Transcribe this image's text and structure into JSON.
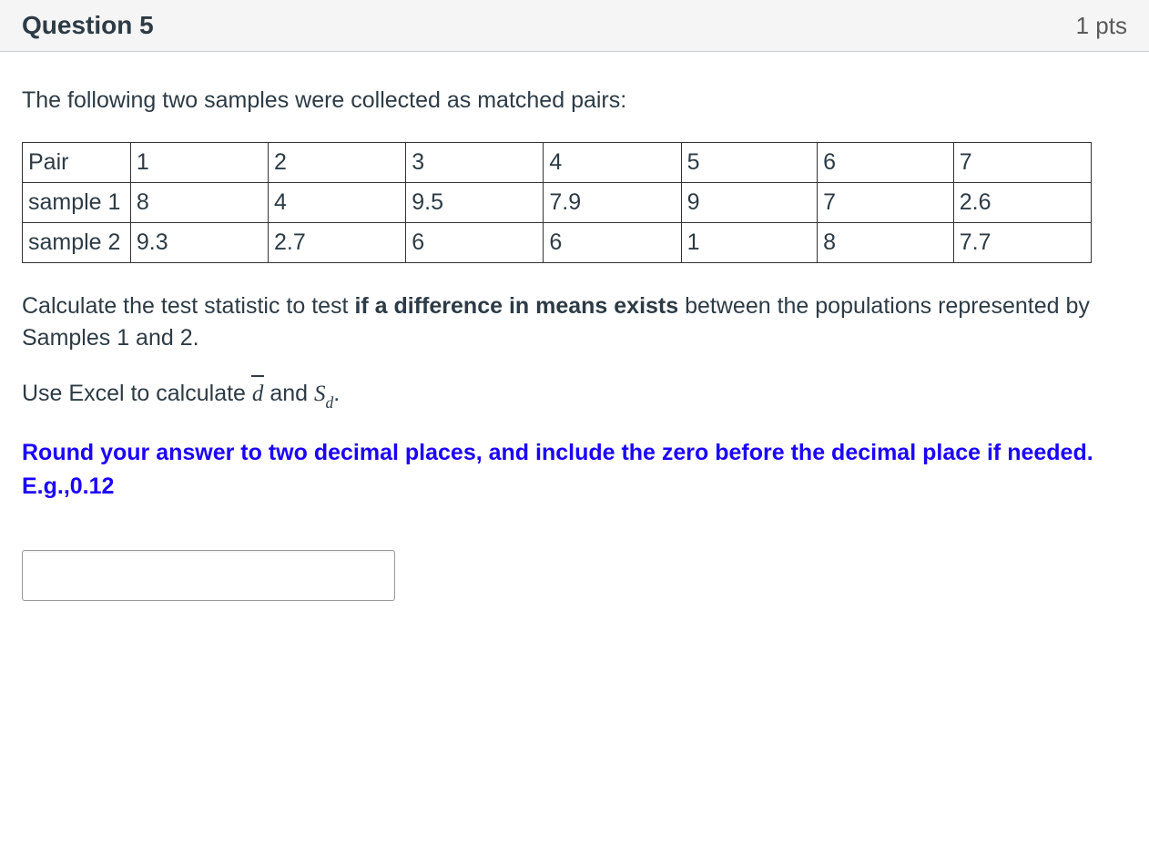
{
  "header": {
    "title": "Question 5",
    "points": "1 pts"
  },
  "body": {
    "intro": "The following two samples were collected as matched pairs:",
    "table": {
      "row0": {
        "label": "Pair",
        "c1": "1",
        "c2": "2",
        "c3": "3",
        "c4": "4",
        "c5": "5",
        "c6": "6",
        "c7": "7"
      },
      "row1": {
        "label": "sample 1",
        "c1": "8",
        "c2": "4",
        "c3": "9.5",
        "c4": "7.9",
        "c5": "9",
        "c6": "7",
        "c7": "2.6"
      },
      "row2": {
        "label": "sample 2",
        "c1": "9.3",
        "c2": "2.7",
        "c3": "6",
        "c4": "6",
        "c5": "1",
        "c6": "8",
        "c7": "7.7"
      }
    },
    "instr1_a": "Calculate the test statistic to test ",
    "instr1_bold": "if a difference in means exists",
    "instr1_b": " between the populations represented by Samples 1 and 2.",
    "instr2_a": "Use Excel to calculate ",
    "instr2_d": "d",
    "instr2_and": " and ",
    "instr2_S": "S",
    "instr2_dsub": "d",
    "instr2_end": ".",
    "rounding": "Round your answer to two decimal places, and include the zero before the decimal place if needed. E.g.,0.12",
    "answer_value": ""
  }
}
